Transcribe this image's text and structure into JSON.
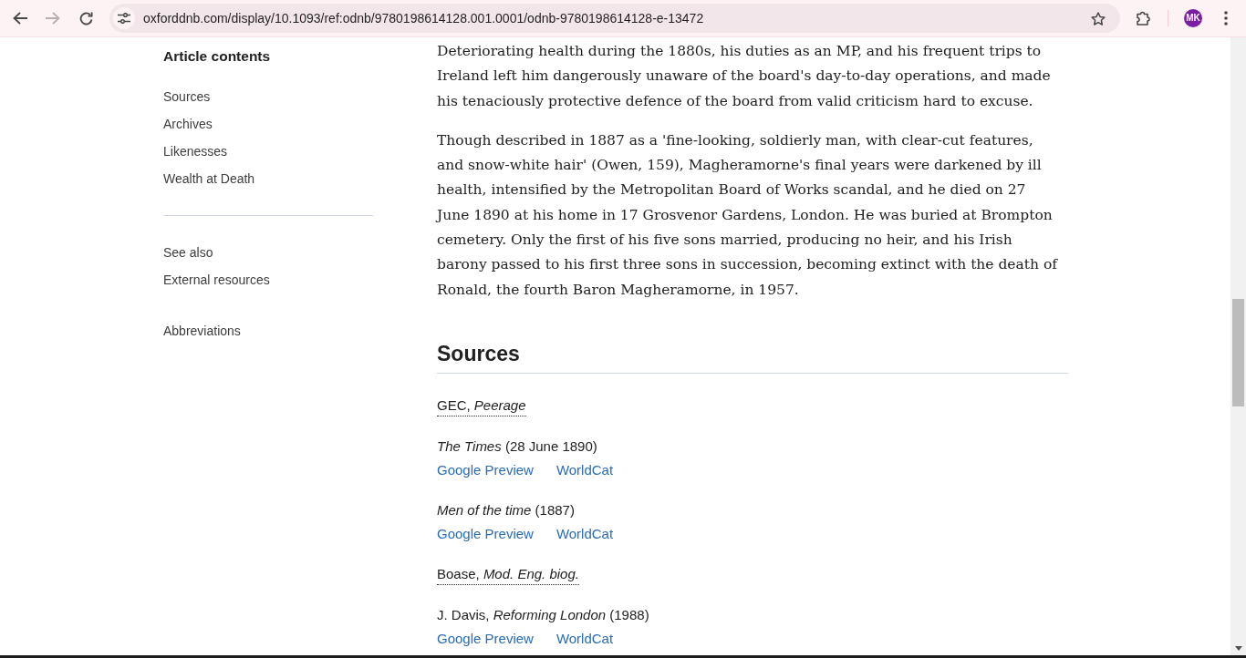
{
  "browser": {
    "nav": [
      {
        "kind": "back",
        "disabled": false
      },
      {
        "kind": "forward",
        "disabled": true
      },
      {
        "kind": "reload",
        "disabled": false
      }
    ],
    "url": "oxforddnb.com/display/10.1093/ref:odnb/9780198614128.001.0001/odnb-9780198614128-e-13472",
    "profile_initials": "MK"
  },
  "sidebar": {
    "title": "Article contents",
    "groups": [
      {
        "items": [
          "Sources",
          "Archives",
          "Likenesses",
          "Wealth at Death"
        ],
        "divider_below": true
      },
      {
        "items": [
          "See also",
          "External resources"
        ],
        "divider_below": false
      },
      {
        "items": [
          "Abbreviations"
        ],
        "divider_below": false
      }
    ]
  },
  "article": {
    "paragraphs": [
      "Deteriorating health during the 1880s, his duties as an MP, and his frequent trips to Ireland left him dangerously unaware of the board's day-to-day operations, and made his tenaciously protective defence of the board from valid criticism hard to excuse.",
      "Though described in 1887 as a 'fine-looking, soldierly man, with clear-cut features, and snow-white hair' (Owen, 159), Magheramorne's final years were darkened by ill health, intensified by the Metropolitan Board of Works scandal, and he died on 27 June 1890 at his home in 17 Grosvenor Gardens, London. He was buried at Brompton cemetery. Only the first of his five sons married, producing no heir, and his Irish barony passed to his first three sons in succession, becoming extinct with the death of Ronald, the fourth Baron Magheramorne, in 1957."
    ],
    "sources": {
      "heading": "Sources",
      "entries": [
        {
          "kind": "abbreviation",
          "text": "GEC, *Peerage*"
        },
        {
          "kind": "citation",
          "text": "*The Times* (28 June 1890)",
          "links": [
            "Google Preview",
            "WorldCat"
          ]
        },
        {
          "kind": "citation",
          "text": "*Men of the time* (1887)",
          "links": [
            "Google Preview",
            "WorldCat"
          ]
        },
        {
          "kind": "abbreviation",
          "text": "Boase, *Mod. Eng. biog.*"
        },
        {
          "kind": "citation",
          "text": "J. Davis, *Reforming London* (1988)",
          "links": [
            "Google Preview",
            "WorldCat"
          ]
        }
      ]
    }
  }
}
